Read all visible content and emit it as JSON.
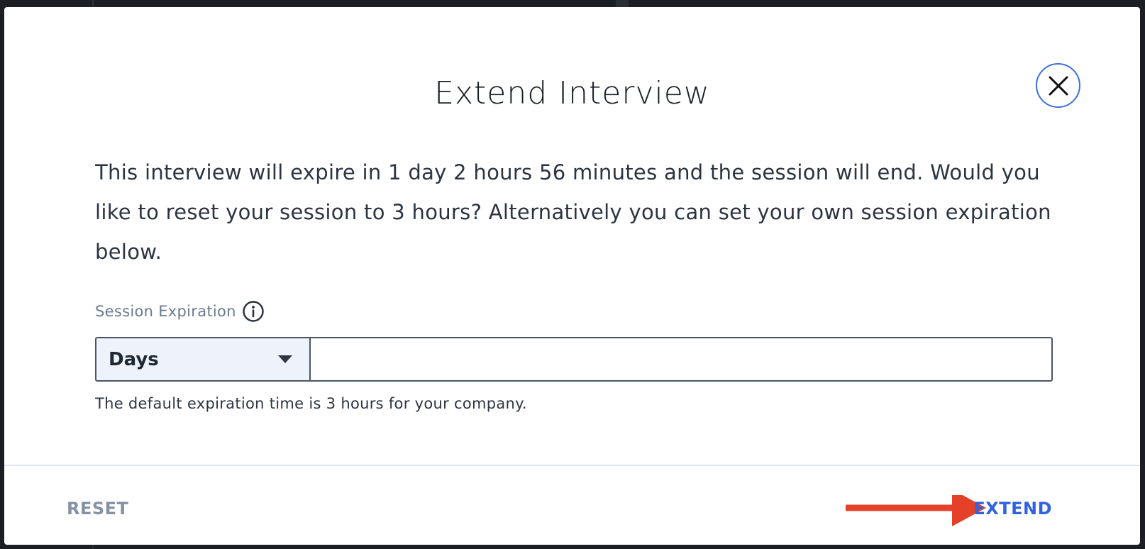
{
  "modal": {
    "title": "Extend Interview",
    "message": "This interview will expire in 1 day 2 hours 56 minutes and the session will end. Would you like to reset your session to 3 hours? Alternatively you can set your own session expiration below.",
    "field_label": "Session Expiration",
    "unit_select": {
      "selected": "Days"
    },
    "value_input": {
      "value": "",
      "placeholder": ""
    },
    "helper_text": "The default expiration time is 3 hours for your company.",
    "reset_label": "RESET",
    "extend_label": "EXTEND"
  },
  "icons": {
    "close": "close-icon",
    "info": "info-icon",
    "caret": "chevron-down-icon",
    "arrow": "arrow-right-icon"
  },
  "colors": {
    "accent": "#2f63e0",
    "close_border": "#3b6fe0",
    "muted_button": "#8592a3",
    "annotation_arrow": "#e5402a",
    "select_bg": "#eef2fa"
  }
}
